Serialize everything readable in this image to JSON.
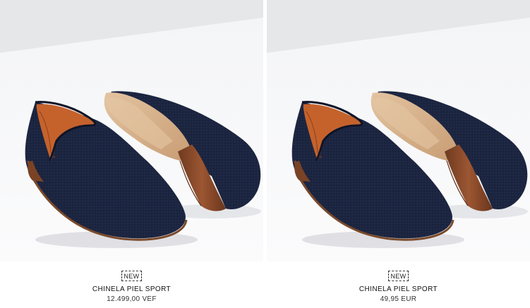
{
  "products": [
    {
      "badge": "NEW",
      "name": "CHINELA PIEL SPORT",
      "price": "12.499,00 VEF",
      "image_icon": "navy-suede-loafers-image"
    },
    {
      "badge": "NEW",
      "name": "CHINELA PIEL SPORT",
      "price": "49,95 EUR",
      "image_icon": "navy-suede-loafers-image"
    }
  ],
  "colors": {
    "shoe_navy": "#1c2540",
    "lining_orange": "#c5622c",
    "sole_tan": "#d8b48e",
    "heel_brown": "#8a4a2a",
    "backdrop_grey": "#e6e7e9",
    "floor_white": "#f7f8f9"
  }
}
